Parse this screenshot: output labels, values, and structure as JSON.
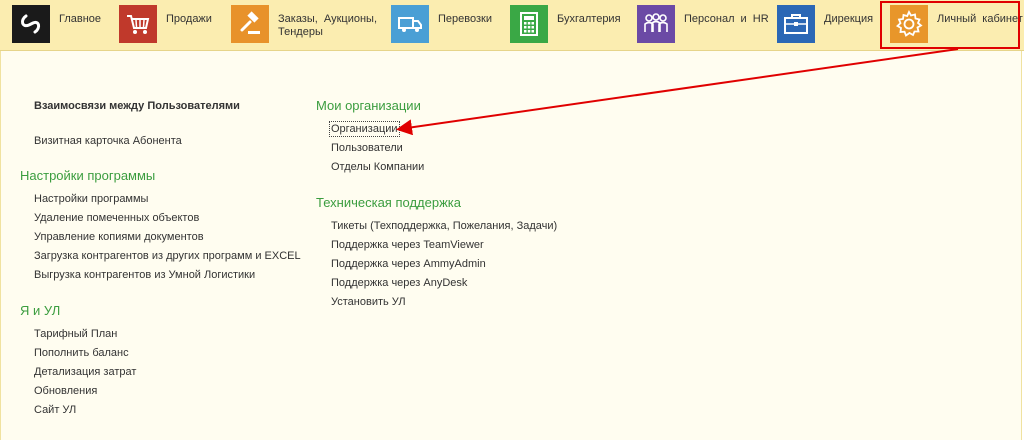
{
  "nav": {
    "items": [
      {
        "key": "home",
        "label": "Главное",
        "icon": "logo-icon",
        "color": "#1a1a1a"
      },
      {
        "key": "sales",
        "label": "Продажи",
        "icon": "cart-icon",
        "color": "#c0392b"
      },
      {
        "key": "orders",
        "label": "Заказы, Аукционы, Тендеры",
        "icon": "gavel-icon",
        "color": "#e8922a"
      },
      {
        "key": "transport",
        "label": "Перевозки",
        "icon": "truck-icon",
        "color": "#4a9fd5"
      },
      {
        "key": "accounting",
        "label": "Бухгалтерия",
        "icon": "calculator-icon",
        "color": "#3aa845"
      },
      {
        "key": "hr",
        "label": "Персонал и HR",
        "icon": "people-icon",
        "color": "#6b4aa5"
      },
      {
        "key": "management",
        "label": "Дирекция",
        "icon": "briefcase-icon",
        "color": "#2b67b5"
      },
      {
        "key": "cabinet",
        "label": "Личный кабинет",
        "icon": "gear-icon",
        "color": "#e8962a"
      }
    ]
  },
  "left": {
    "relations_link": "Взаимосвязи между Пользователями",
    "card_link": "Визитная карточка Абонента",
    "settings": {
      "title": "Настройки программы",
      "items": [
        "Настройки программы",
        "Удаление помеченных объектов",
        "Управление копиями документов",
        "Загрузка контрагентов из других программ и EXCEL",
        "Выгрузка контрагентов из Умной Логистики"
      ]
    },
    "ya_ul": {
      "title": "Я и УЛ",
      "items": [
        "Тарифный План",
        "Пополнить баланс",
        "Детализация затрат",
        "Обновления",
        "Сайт УЛ"
      ]
    }
  },
  "right": {
    "my_orgs": {
      "title": "Мои организации",
      "items": [
        "Организации",
        "Пользователи",
        "Отделы Компании"
      ]
    },
    "support": {
      "title": "Техническая поддержка",
      "items": [
        "Тикеты (Техподдержка, Пожелания, Задачи)",
        "Поддержка через TeamViewer",
        "Поддержка через AmmyAdmin",
        "Поддержка через AnyDesk",
        "Установить УЛ"
      ]
    }
  },
  "colors": {
    "topbar_bg": "#fbedb0",
    "content_bg": "#fffdf0",
    "section_title": "#3b9d3f",
    "annotation": "#e00000"
  }
}
